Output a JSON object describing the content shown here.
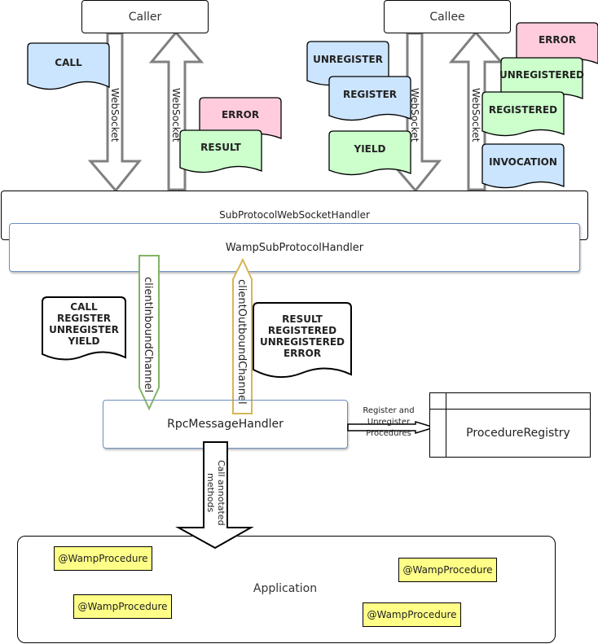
{
  "caller": {
    "label": "Caller"
  },
  "callee": {
    "label": "Callee"
  },
  "websocket_label": "WebSocket",
  "caller_messages": {
    "outbound": [
      "CALL"
    ],
    "inbound": [
      "ERROR",
      "RESULT"
    ]
  },
  "callee_messages": {
    "outbound": [
      "UNREGISTER",
      "REGISTER",
      "YIELD"
    ],
    "inbound": [
      "ERROR",
      "UNREGISTERED",
      "REGISTERED",
      "INVOCATION"
    ]
  },
  "handlers": {
    "subprotocol_ws": "SubProtocolWebSocketHandler",
    "wamp_subprotocol": "WampSubProtocolHandler",
    "rpc": "RpcMessageHandler"
  },
  "channels": {
    "inbound": {
      "label": "clientInboundChannel",
      "messages": "CALL\nREGISTER\nUNREGISTER\nYIELD"
    },
    "outbound": {
      "label": "clientOutboundChannel",
      "messages": "RESULT\nREGISTERED\nUNREGISTERED\nERROR"
    }
  },
  "registry": {
    "label": "ProcedureRegistry",
    "edge_label": "Register and Unregister Procedures"
  },
  "call_arrow_label": "Call annotated methods",
  "application": {
    "label": "Application",
    "procedures": [
      "@WampProcedure",
      "@WampProcedure",
      "@WampProcedure",
      "@WampProcedure"
    ]
  },
  "colors": {
    "blue_msg": "#cce5ff",
    "green_msg": "#ccffcc",
    "pink_msg": "#ffccdd",
    "handler_border": "#6c8ebf",
    "inbound_channel": "#82b366",
    "outbound_channel": "#d6b656",
    "annotation": "#ffff88"
  }
}
